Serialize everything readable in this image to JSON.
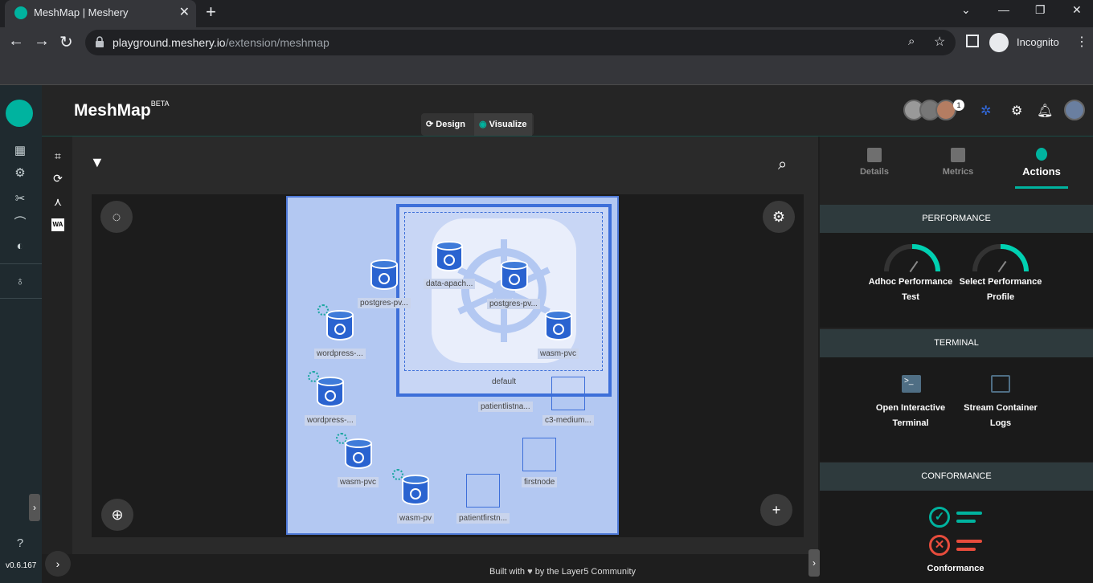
{
  "browser": {
    "tab_title": "MeshMap | Meshery",
    "url_host": "playground.meshery.io",
    "url_path": "/extension/meshmap",
    "incognito_label": "Incognito"
  },
  "app": {
    "brand": "MeshMap",
    "brand_sup": "BETA",
    "mode_design": "Design",
    "mode_visualize": "Visualize",
    "notification_count": "1",
    "version": "v0.6.167"
  },
  "canvas": {
    "namespace_label": "default",
    "nodes": [
      {
        "label": "data-apach..."
      },
      {
        "label": "postgres-pv..."
      },
      {
        "label": "wasm-pvc"
      },
      {
        "label": "postgres-pv..."
      },
      {
        "label": "wordpress-..."
      },
      {
        "label": "wordpress-..."
      },
      {
        "label": "wasm-pvc"
      },
      {
        "label": "wasm-pv"
      },
      {
        "label": "patientlistna..."
      },
      {
        "label": "c3-medium..."
      },
      {
        "label": "firstnode"
      },
      {
        "label": "patientfirstn..."
      }
    ]
  },
  "footer": {
    "built_with": "Built with",
    "community": "by the Layer5 Community"
  },
  "panel": {
    "tabs": [
      {
        "label": "Details"
      },
      {
        "label": "Metrics"
      },
      {
        "label": "Actions"
      }
    ],
    "performance_header": "PERFORMANCE",
    "adhoc_line1": "Adhoc Performance",
    "adhoc_line2": "Test",
    "select_line1": "Select Performance",
    "select_line2": "Profile",
    "terminal_header": "TERMINAL",
    "open_term_line1": "Open Interactive",
    "open_term_line2": "Terminal",
    "stream_line1": "Stream Container",
    "stream_line2": "Logs",
    "conformance_header": "CONFORMANCE",
    "conformance_label": "Conformance"
  },
  "colors": {
    "accent": "#00b39f",
    "gauge": "#00d1b2",
    "fail": "#e74c3c"
  }
}
